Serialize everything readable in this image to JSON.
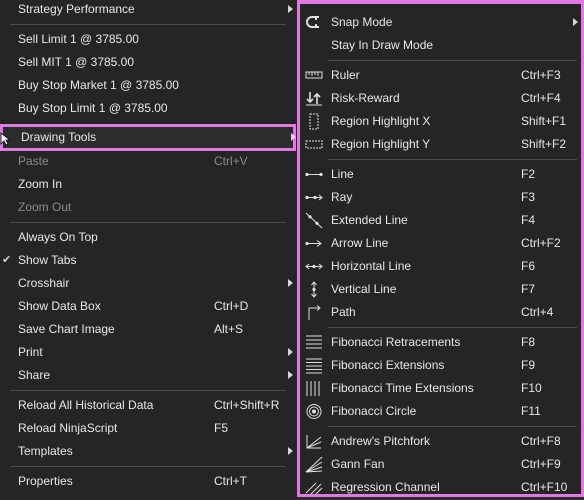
{
  "left_menu": {
    "items": [
      {
        "label": "Strategy Performance",
        "submenu": true
      },
      {
        "label": "Sell Limit 1 @ 3785.00"
      },
      {
        "label": "Sell MIT 1 @ 3785.00"
      },
      {
        "label": "Buy Stop Market 1 @ 3785.00"
      },
      {
        "label": "Buy Stop Limit 1 @ 3785.00"
      },
      {
        "label": "Drawing Tools",
        "submenu": true
      },
      {
        "label": "Paste",
        "shortcut": "Ctrl+V",
        "disabled": true
      },
      {
        "label": "Zoom In"
      },
      {
        "label": "Zoom Out",
        "disabled": true
      },
      {
        "label": "Always On Top"
      },
      {
        "label": "Show Tabs",
        "checked": true
      },
      {
        "label": "Crosshair",
        "submenu": true
      },
      {
        "label": "Show Data Box",
        "shortcut": "Ctrl+D"
      },
      {
        "label": "Save Chart Image",
        "shortcut": "Alt+S"
      },
      {
        "label": "Print",
        "submenu": true
      },
      {
        "label": "Share",
        "submenu": true
      },
      {
        "label": "Reload All Historical Data",
        "shortcut": "Ctrl+Shift+R"
      },
      {
        "label": "Reload NinjaScript",
        "shortcut": "F5"
      },
      {
        "label": "Templates",
        "submenu": true
      },
      {
        "label": "Properties",
        "shortcut": "Ctrl+T"
      }
    ]
  },
  "drawing_tools_menu": {
    "items": [
      {
        "label": "Snap Mode",
        "icon": "magnet-icon",
        "submenu": true
      },
      {
        "label": "Stay In Draw Mode"
      },
      {
        "label": "Ruler",
        "shortcut": "Ctrl+F3",
        "icon": "ruler-icon"
      },
      {
        "label": "Risk-Reward",
        "shortcut": "Ctrl+F4",
        "icon": "risk-reward-icon"
      },
      {
        "label": "Region Highlight X",
        "shortcut": "Shift+F1",
        "icon": "region-highlight-x-icon"
      },
      {
        "label": "Region Highlight Y",
        "shortcut": "Shift+F2",
        "icon": "region-highlight-y-icon"
      },
      {
        "label": "Line",
        "shortcut": "F2",
        "icon": "line-icon"
      },
      {
        "label": "Ray",
        "shortcut": "F3",
        "icon": "ray-icon"
      },
      {
        "label": "Extended Line",
        "shortcut": "F4",
        "icon": "extended-line-icon"
      },
      {
        "label": "Arrow Line",
        "shortcut": "Ctrl+F2",
        "icon": "arrow-line-icon"
      },
      {
        "label": "Horizontal Line",
        "shortcut": "F6",
        "icon": "horizontal-line-icon"
      },
      {
        "label": "Vertical Line",
        "shortcut": "F7",
        "icon": "vertical-line-icon"
      },
      {
        "label": "Path",
        "shortcut": "Ctrl+4",
        "icon": "path-icon"
      },
      {
        "label": "Fibonacci Retracements",
        "shortcut": "F8",
        "icon": "fibonacci-retracements-icon"
      },
      {
        "label": "Fibonacci Extensions",
        "shortcut": "F9",
        "icon": "fibonacci-extensions-icon"
      },
      {
        "label": "Fibonacci Time Extensions",
        "shortcut": "F10",
        "icon": "fibonacci-time-extensions-icon"
      },
      {
        "label": "Fibonacci Circle",
        "shortcut": "F11",
        "icon": "fibonacci-circle-icon"
      },
      {
        "label": "Andrew's Pitchfork",
        "shortcut": "Ctrl+F8",
        "icon": "pitchfork-icon"
      },
      {
        "label": "Gann Fan",
        "shortcut": "Ctrl+F9",
        "icon": "gann-fan-icon"
      },
      {
        "label": "Regression Channel",
        "shortcut": "Ctrl+F10",
        "icon": "regression-channel-icon"
      }
    ]
  },
  "colors": {
    "menu_background": "#252525",
    "highlight_border": "#e07ae0",
    "text": "#e8e8e8",
    "disabled_text": "#8a8a8a",
    "separator": "#4a4a4a"
  }
}
